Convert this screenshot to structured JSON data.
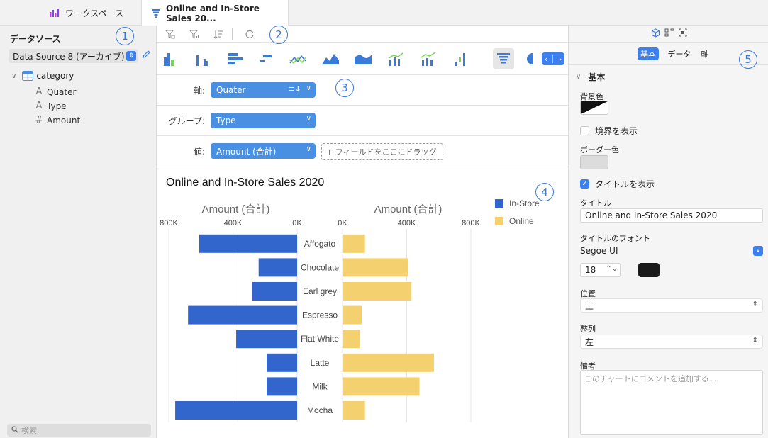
{
  "tabs": {
    "workspace": "ワークスペース",
    "chart": "Online and In-Store Sales 20..."
  },
  "left": {
    "title": "データソース",
    "data_source": "Data Source 8 (アーカイブ)",
    "tree_root": "category",
    "fields": [
      {
        "icon": "A",
        "label": "Quater"
      },
      {
        "icon": "A",
        "label": "Type"
      },
      {
        "icon": "#",
        "label": "Amount"
      }
    ],
    "search_placeholder": "検索"
  },
  "badges": [
    "1",
    "2",
    "3",
    "4",
    "5"
  ],
  "config": {
    "axis_label": "軸:",
    "axis_value": "Quater",
    "group_label": "グループ:",
    "group_value": "Type",
    "value_label": "値:",
    "value_value": "Amount (合計)",
    "dropzone": "+ フィールドをここにドラッグ"
  },
  "chart_data": {
    "type": "bar",
    "title": "Online and In-Store Sales 2020",
    "categories": [
      "Affogato",
      "Chocolate",
      "Earl grey",
      "Espresso",
      "Flat White",
      "Latte",
      "Milk",
      "Mocha"
    ],
    "series": [
      {
        "name": "In-Store",
        "color": "#3366cc",
        "values": [
          610000,
          240000,
          280000,
          680000,
          380000,
          190000,
          190000,
          760000
        ]
      },
      {
        "name": "Online",
        "color": "#f4d06f",
        "values": [
          140000,
          410000,
          430000,
          120000,
          110000,
          570000,
          480000,
          140000
        ]
      }
    ],
    "left_axis": {
      "label": "Amount (合計)",
      "ticks": [
        "800K",
        "400K",
        "0K"
      ],
      "range": [
        800000,
        0
      ]
    },
    "right_axis": {
      "label": "Amount (合計)",
      "ticks": [
        "0K",
        "400K",
        "800K"
      ],
      "range": [
        0,
        800000
      ]
    },
    "legend_position": "top-right",
    "grid": true
  },
  "right": {
    "tabs": [
      "基本",
      "データ",
      "軸"
    ],
    "section": "基本",
    "bg_color_label": "背景色",
    "show_border": "境界を表示",
    "border_color_label": "ボーダー色",
    "show_title": "タイトルを表示",
    "title_label": "タイトル",
    "title_value": "Online and In-Store Sales 2020",
    "font_label": "タイトルのフォント",
    "font_value": "Segoe UI",
    "font_size": "18",
    "position_label": "位置",
    "position_value": "上",
    "align_label": "整列",
    "align_value": "左",
    "notes_label": "備考",
    "notes_placeholder": "このチャートにコメントを追加する..."
  }
}
